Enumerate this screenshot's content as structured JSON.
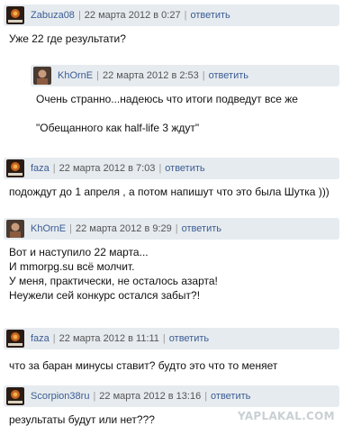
{
  "comments": [
    {
      "user": "Zabuza08",
      "date": "22 марта 2012 в 0:27",
      "reply": "ответить",
      "avatar": "mmorpg-logo-avatar",
      "lines": [
        "Уже 22 где результати?"
      ]
    },
    {
      "user": "KhOrnE",
      "date": "22 марта 2012 в 2:53",
      "reply": "ответить",
      "avatar": "photo-avatar",
      "lines": [
        "Очень странно...надеюсь что итоги подведут все же",
        "",
        "\"Обещанного как half-life 3 ждут\""
      ]
    },
    {
      "user": "faza",
      "date": "22 марта 2012 в 7:03",
      "reply": "ответить",
      "avatar": "mmorpg-logo-avatar",
      "lines": [
        "подождут до 1 апреля , а потом напишут что это была Шутка )))"
      ]
    },
    {
      "user": "KhOrnE",
      "date": "22 марта 2012 в 9:29",
      "reply": "ответить",
      "avatar": "photo-avatar",
      "lines": [
        "Вот и наступило 22 марта...",
        "И mmorpg.su всё молчит.",
        "У меня, практически, не осталось азарта!",
        "Неужели сей конкурс остался забыт?!"
      ]
    },
    {
      "user": "faza",
      "date": "22 марта 2012 в 11:11",
      "reply": "ответить",
      "avatar": "mmorpg-logo-avatar",
      "lines": [
        "что за баран минусы ставит? будто это что то меняет"
      ]
    },
    {
      "user": "Scorpion38ru",
      "date": "22 марта 2012 в 13:16",
      "reply": "ответить",
      "avatar": "mmorpg-logo-avatar",
      "lines": [
        "результаты будут или нет???"
      ]
    }
  ],
  "separator": "|",
  "watermark": "YAPLAKAL.COM",
  "colors": {
    "header_bg": "#e6ebef",
    "link": "#3b5c93"
  }
}
